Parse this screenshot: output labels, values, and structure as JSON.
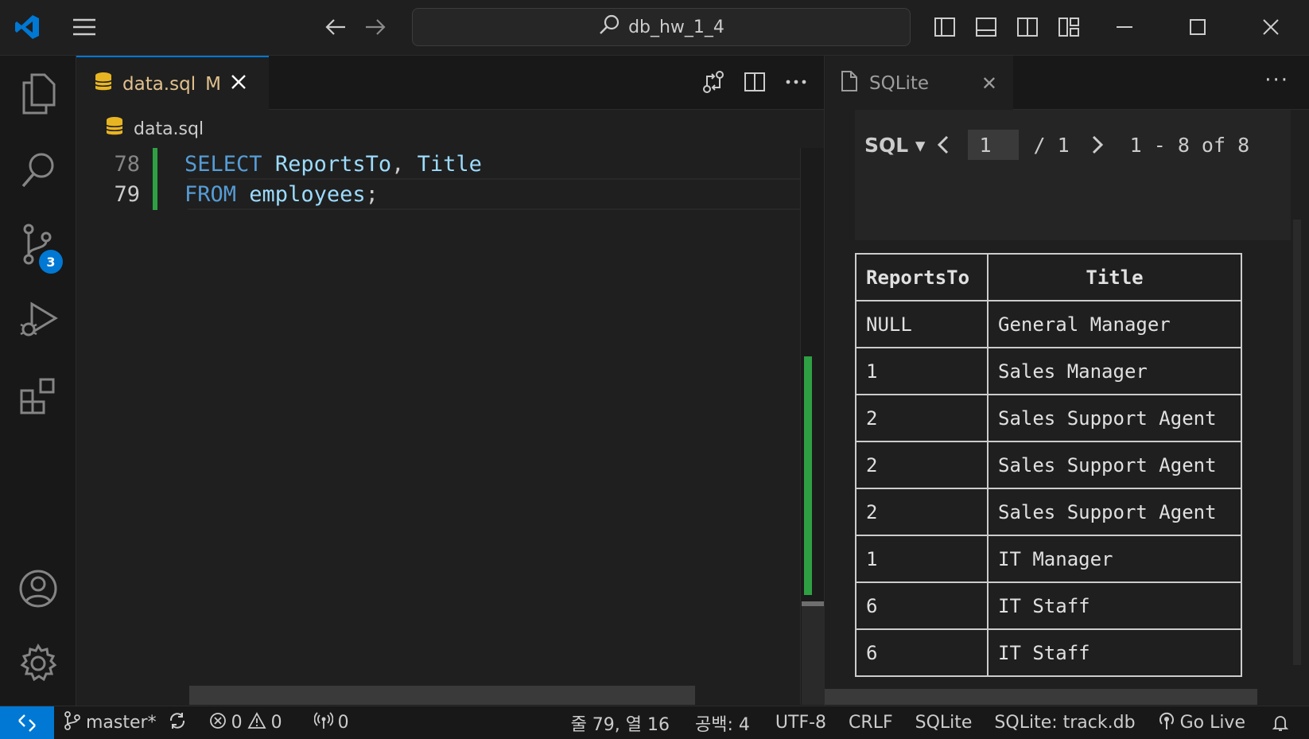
{
  "window": {
    "search_text": "db_hw_1_4"
  },
  "activity": {
    "scm_badge": "3"
  },
  "editor": {
    "tab": {
      "name": "data.sql",
      "status": "M"
    },
    "breadcrumb": "data.sql",
    "lines": [
      {
        "num": "78",
        "tokens": [
          [
            "kw",
            "SELECT"
          ],
          [
            "pl",
            " "
          ],
          [
            "id",
            "ReportsTo"
          ],
          [
            "pl",
            ", "
          ],
          [
            "id",
            "Title"
          ]
        ]
      },
      {
        "num": "79",
        "tokens": [
          [
            "kw",
            "FROM"
          ],
          [
            "pl",
            " "
          ],
          [
            "id",
            "employees"
          ],
          [
            "pl",
            ";"
          ]
        ]
      }
    ]
  },
  "panel": {
    "tab_label": "SQLite",
    "toolbar": {
      "mode": "SQL",
      "page_value": "1",
      "page_total": "/ 1",
      "range": "1 - 8 of 8"
    },
    "table": {
      "columns": [
        "ReportsTo",
        "Title"
      ],
      "rows": [
        [
          "NULL",
          "General Manager"
        ],
        [
          "1",
          "Sales Manager"
        ],
        [
          "2",
          "Sales Support Agent"
        ],
        [
          "2",
          "Sales Support Agent"
        ],
        [
          "2",
          "Sales Support Agent"
        ],
        [
          "1",
          "IT Manager"
        ],
        [
          "6",
          "IT Staff"
        ],
        [
          "6",
          "IT Staff"
        ]
      ]
    }
  },
  "statusbar": {
    "branch": "master*",
    "errors": "0",
    "warnings": "0",
    "ports": "0",
    "position": "줄 79, 열 16",
    "spaces": "공백: 4",
    "encoding": "UTF-8",
    "eol": "CRLF",
    "language": "SQLite",
    "db": "SQLite: track.db",
    "golive": "Go Live"
  },
  "colors": {
    "accent": "#0078d4",
    "keyword": "#569cd6",
    "identifier": "#9cdcfe",
    "modified": "#e2c08d",
    "added": "#2ea043"
  }
}
